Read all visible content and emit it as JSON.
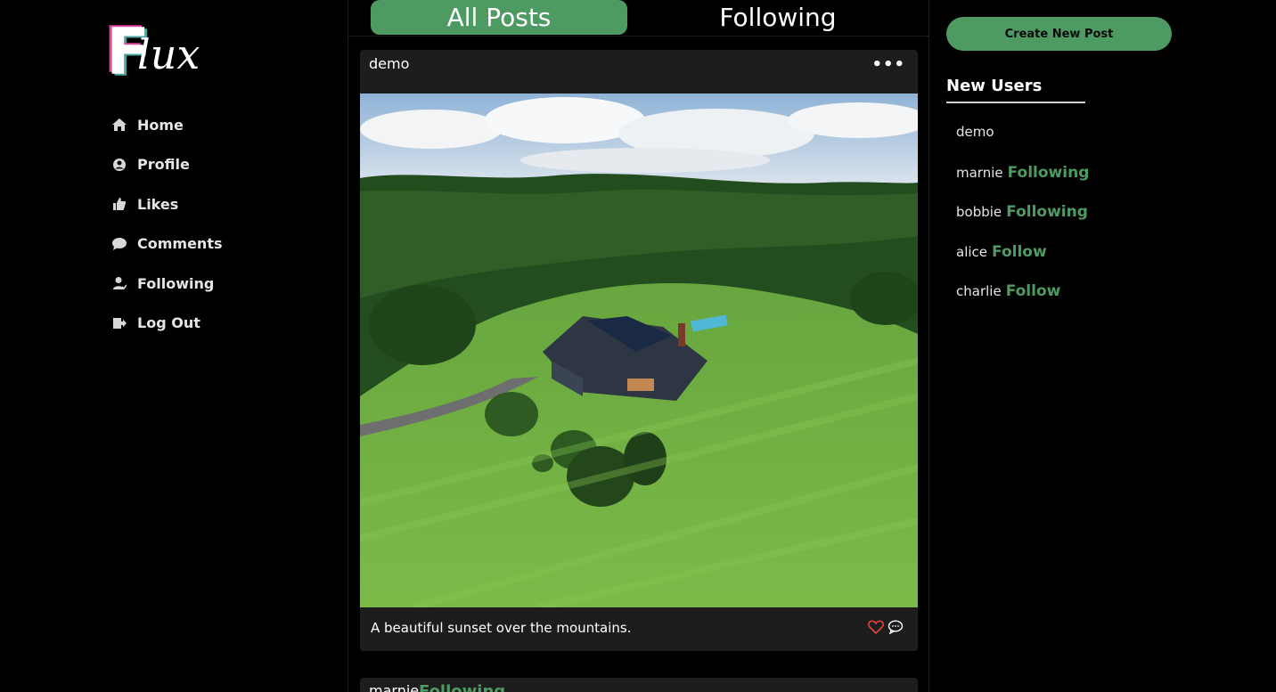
{
  "brand": {
    "logo_letter": "F",
    "logo_rest": "lux"
  },
  "nav": {
    "items": [
      {
        "label": "Home",
        "icon": "home-icon"
      },
      {
        "label": "Profile",
        "icon": "user-circle-icon"
      },
      {
        "label": "Likes",
        "icon": "thumbs-up-icon"
      },
      {
        "label": "Comments",
        "icon": "comment-icon"
      },
      {
        "label": "Following",
        "icon": "user-follow-icon"
      },
      {
        "label": "Log Out",
        "icon": "logout-icon"
      }
    ]
  },
  "tabs": {
    "all_posts": "All Posts",
    "following": "Following"
  },
  "feed": {
    "post": {
      "username": "demo",
      "menu": "•••",
      "caption": "A beautiful sunset over the mountains.",
      "image_alt": "Aerial view of a house with solar panels and pool surrounded by green lawns and forest"
    },
    "next_post": {
      "username": "marnie",
      "status": "Following"
    }
  },
  "right": {
    "create_post_label": "Create New Post",
    "new_users_title": "New Users",
    "users": [
      {
        "name": "demo",
        "action": ""
      },
      {
        "name": "marnie",
        "action": "Following"
      },
      {
        "name": "bobbie",
        "action": "Following"
      },
      {
        "name": "alice",
        "action": "Follow"
      },
      {
        "name": "charlie",
        "action": "Follow"
      }
    ]
  },
  "colors": {
    "accent": "#4e9a63",
    "background": "#000000",
    "card": "#1d1d1d",
    "heart": "#e0443a",
    "logo_pink": "#e04a9a",
    "logo_teal": "#4aa6a0"
  }
}
